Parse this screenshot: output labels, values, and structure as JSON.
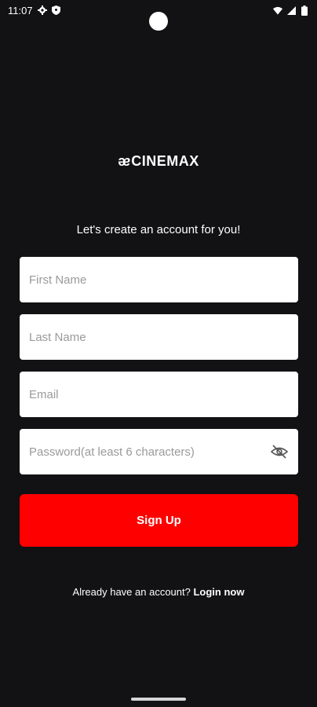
{
  "status_bar": {
    "time": "11:07",
    "icons_left": [
      "settings-gear-icon",
      "shield-icon"
    ],
    "icons_right": [
      "wifi-icon",
      "signal-icon",
      "battery-icon"
    ]
  },
  "logo": {
    "mark": "ᴂ",
    "text": "CINEMAX"
  },
  "form": {
    "heading": "Let's create an account for you!",
    "first_name": {
      "value": "",
      "placeholder": "First Name"
    },
    "last_name": {
      "value": "",
      "placeholder": "Last Name"
    },
    "email": {
      "value": "",
      "placeholder": "Email"
    },
    "password": {
      "value": "",
      "placeholder": "Password(at least 6 characters)",
      "toggle_icon": "eye-off-icon"
    },
    "submit_label": "Sign Up",
    "submit_color": "#ff0000"
  },
  "footer": {
    "prompt": "Already have an account?",
    "link_label": "Login now"
  },
  "colors": {
    "background": "#121113",
    "accent": "#ff0000"
  }
}
